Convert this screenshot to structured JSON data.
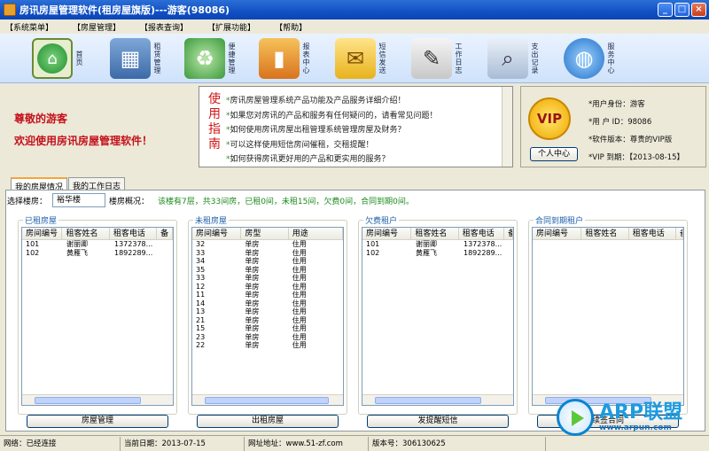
{
  "window": {
    "title": "房讯房屋管理软件(租房屋旗版)---游客(98086)"
  },
  "menu": [
    "【系统菜单】",
    "【房屋管理】",
    "【报表查询】",
    "【扩展功能】",
    "【帮助】"
  ],
  "toolbar": [
    {
      "label": "首页",
      "icon": "home-icon"
    },
    {
      "label": "租赁管理",
      "icon": "building-icon"
    },
    {
      "label": "便捷管理",
      "icon": "recycle-house-icon"
    },
    {
      "label": "报表中心",
      "icon": "chart-icon"
    },
    {
      "label": "短信发送",
      "icon": "envelope-icon"
    },
    {
      "label": "工作日志",
      "icon": "notebook-icon"
    },
    {
      "label": "支出记录",
      "icon": "magnifier-icon"
    },
    {
      "label": "服务中心",
      "icon": "globe-icon"
    }
  ],
  "welcome": {
    "line1": "尊敬的游客",
    "line2": "欢迎使用房讯房屋管理软件！"
  },
  "guide": {
    "tag": "使用指南",
    "items": [
      "房讯房屋管理系统产品功能及产品服务详细介绍！",
      "如果您对房讯的产品和服务有任何疑问的，请看常见问题！",
      "如何使用房讯房屋出租管理系统管理房屋及财务？",
      "可以这样使用短信房间催租，交租提醒！",
      "如何获得房讯更好用的产品和更实用的服务？"
    ]
  },
  "account": {
    "badge": "VIP",
    "button": "个人中心",
    "lines": [
      "*用户身份：游客",
      "*用 户 ID：98086",
      "*软件版本：尊贵的VIP版",
      "*VIP 到期：【2013-08-15】"
    ]
  },
  "tabs": [
    "我的房屋情况",
    "我的工作日志"
  ],
  "filter": {
    "building_label": "选择楼房：",
    "building_value": "裕华楼",
    "overview_label": "楼房概况：",
    "overview_text": "该楼有7层，共33间房，已租0间，未租15间，欠费0间，合同到期0间。"
  },
  "groups": [
    {
      "title": "已租房屋",
      "columns": [
        "房间编号",
        "租客姓名",
        "租客电话",
        "备"
      ],
      "rows": [
        [
          "101",
          "谢丽卿",
          "1372378..."
        ],
        [
          "102",
          "黄雁飞",
          "1892289..."
        ]
      ],
      "button": "房屋管理"
    },
    {
      "title": "未租房屋",
      "columns": [
        "房间编号",
        "房型",
        "用途"
      ],
      "rows": [
        [
          "32",
          "单房",
          "住用"
        ],
        [
          "33",
          "单房",
          "住用"
        ],
        [
          "34",
          "单房",
          "住用"
        ],
        [
          "35",
          "单房",
          "住用"
        ],
        [
          "33",
          "单房",
          "住用"
        ],
        [
          "12",
          "单房",
          "住用"
        ],
        [
          "11",
          "单房",
          "住用"
        ],
        [
          "14",
          "单房",
          "住用"
        ],
        [
          "13",
          "单房",
          "住用"
        ],
        [
          "21",
          "单房",
          "住用"
        ],
        [
          "15",
          "单房",
          "住用"
        ],
        [
          "23",
          "单房",
          "住用"
        ],
        [
          "22",
          "单房",
          "住用"
        ]
      ],
      "button": "出租房屋"
    },
    {
      "title": "欠费租户",
      "columns": [
        "房间编号",
        "租客姓名",
        "租客电话",
        "备"
      ],
      "rows": [
        [
          "101",
          "谢丽卿",
          "1372378..."
        ],
        [
          "102",
          "黄雁飞",
          "1892289..."
        ]
      ],
      "button": "发提醒短信"
    },
    {
      "title": "合同到期租户",
      "columns": [
        "房间编号",
        "租客姓名",
        "租客电话",
        "备"
      ],
      "rows": [],
      "button": "续签合同"
    }
  ],
  "status": {
    "network": "网络：已经连接",
    "date": "当前日期：2013-07-15",
    "site": "网址地址：www.51-zf.com",
    "version": "版本号：306130625"
  },
  "watermark": {
    "title": "ARP联盟",
    "url": "www.arpun.com"
  }
}
